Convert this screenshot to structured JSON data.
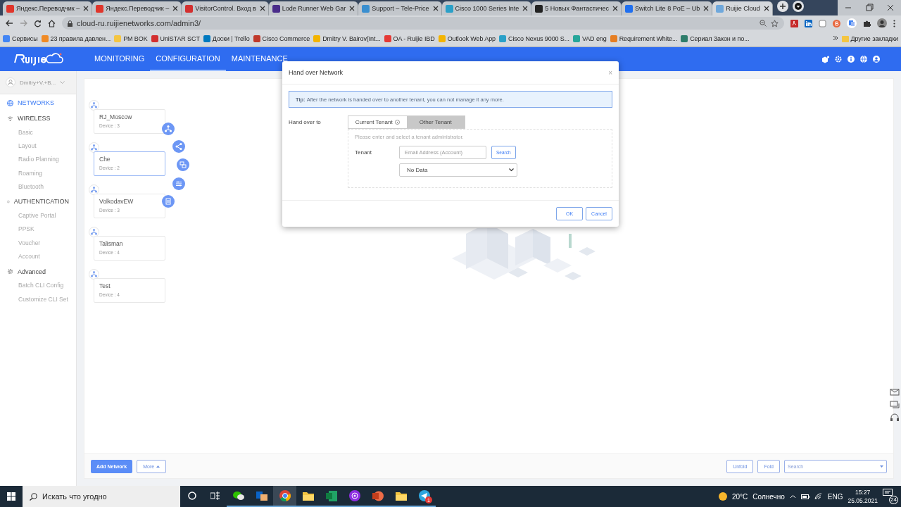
{
  "browser": {
    "tabs": [
      {
        "title": "Яндекс.Переводчик –",
        "color": "#e0352b",
        "selected": false
      },
      {
        "title": "Яндекс.Переводчик –",
        "color": "#e0352b",
        "selected": false
      },
      {
        "title": "VisitorControl. Вход в",
        "color": "#d32f2f",
        "selected": false
      },
      {
        "title": "Lode Runner Web Gar",
        "color": "#4a2c8a",
        "selected": false
      },
      {
        "title": "Support – Tele-Price",
        "color": "#3a8fd0",
        "selected": false
      },
      {
        "title": "Cisco 1000 Series Inte",
        "color": "#2aa0c8",
        "selected": false
      },
      {
        "title": "5 Новых Фантастичес",
        "color": "#222222",
        "selected": false
      },
      {
        "title": "Switch Lite 8 PoE – Ub",
        "color": "#1f6ff0",
        "selected": false
      },
      {
        "title": "Ruijie Cloud",
        "color": "#6fa8dc",
        "selected": true
      }
    ],
    "url": "cloud-ru.ruijienetworks.com/admin3/",
    "bookmarks": [
      {
        "label": "Сервисы",
        "color": "#4285f4"
      },
      {
        "label": "23 правила давлен...",
        "color": "#f08a24"
      },
      {
        "label": "PM BOK",
        "color": "#f4c542"
      },
      {
        "label": "UniSTAR SCT",
        "color": "#d32f2f"
      },
      {
        "label": "Доски | Trello",
        "color": "#0079bf"
      },
      {
        "label": "Cisco Commerce",
        "color": "#c0392b"
      },
      {
        "label": "Dmitry V. Bairov(Int...",
        "color": "#f4b400"
      },
      {
        "label": "OA - Ruijie IBD",
        "color": "#e53935"
      },
      {
        "label": "Outlook Web App",
        "color": "#f4b400"
      },
      {
        "label": "Cisco Nexus 9000 S...",
        "color": "#2aa0c8"
      },
      {
        "label": "VAD eng",
        "color": "#26a69a"
      },
      {
        "label": "Requirement White...",
        "color": "#e67e22"
      },
      {
        "label": "Сериал Закон и по...",
        "color": "#2e7d6b"
      }
    ],
    "other_bookmarks": "Другие закладки"
  },
  "app": {
    "nav": [
      {
        "label": "MONITORING",
        "selected": false
      },
      {
        "label": "CONFIGURATION",
        "selected": true
      },
      {
        "label": "MAINTENANCE",
        "selected": false
      }
    ],
    "account": "Dmitry+V.+B...",
    "sidebar": [
      {
        "label": "NETWORKS",
        "kind": "globe",
        "selected": true
      },
      {
        "label": "WIRELESS",
        "kind": "wifi",
        "selected": false,
        "children": [
          {
            "label": "Basic",
            "selected": false
          },
          {
            "label": "Layout",
            "selected": false
          },
          {
            "label": "Radio Planning",
            "selected": false
          },
          {
            "label": "Roaming",
            "selected": false
          },
          {
            "label": "Bluetooth",
            "selected": false
          }
        ]
      },
      {
        "label": "AUTHENTICATION",
        "kind": "info",
        "selected": false,
        "children": [
          {
            "label": "Captive Portal",
            "selected": false
          },
          {
            "label": "PPSK",
            "selected": false
          },
          {
            "label": "Voucher",
            "selected": false
          },
          {
            "label": "Account",
            "selected": false
          }
        ]
      },
      {
        "label": "Advanced",
        "kind": "gear",
        "selected": false,
        "children": [
          {
            "label": "Batch CLI Config",
            "selected": false
          },
          {
            "label": "Customize CLI Set",
            "selected": false
          }
        ]
      }
    ],
    "networks": [
      {
        "name": "RJ_Moscow",
        "devices": "Device : 3",
        "selected": false
      },
      {
        "name": "Che",
        "devices": "Device : 2",
        "selected": true
      },
      {
        "name": "VolkodavEW",
        "devices": "Device : 3",
        "selected": false
      },
      {
        "name": "Talisman",
        "devices": "Device : 4",
        "selected": false
      },
      {
        "name": "Test",
        "devices": "Device : 4",
        "selected": false
      }
    ],
    "footer": {
      "add": "Add Network",
      "more": "More",
      "unfold": "Unfold",
      "fold": "Fold",
      "search_placeholder": "Search"
    }
  },
  "dialog": {
    "title": "Hand over Network",
    "close": "×",
    "tip_label": "Tip:",
    "tip": "After the network is handed over to another tenant, you can not manage it any more.",
    "hand_over_label": "Hand over to",
    "options": [
      {
        "label": "Current Tenant",
        "selected": false
      },
      {
        "label": "Other Tenant",
        "selected": true
      }
    ],
    "hint": "Please enter and select a tenant administrator.",
    "tenant_label": "Tenant",
    "email_placeholder": "Email Address (Account)",
    "search": "Search",
    "select_value": "No Data",
    "ok": "OK",
    "cancel": "Cancel"
  },
  "taskbar": {
    "search_placeholder": "Искать что угодно",
    "apps": [
      {
        "kind": "chat",
        "selected": false
      },
      {
        "kind": "mail",
        "selected": false
      },
      {
        "kind": "browser",
        "selected": true
      },
      {
        "kind": "folder",
        "selected": false
      },
      {
        "kind": "sheet",
        "selected": false
      },
      {
        "kind": "podcast",
        "selected": false
      },
      {
        "kind": "slides",
        "selected": false
      },
      {
        "kind": "folder",
        "selected": false
      },
      {
        "kind": "messenger",
        "selected": false,
        "badge": "1"
      }
    ],
    "temperature": "20°C",
    "weather": "Солнечно",
    "language": "ENG",
    "time": "15:27",
    "date": "25.05.2021",
    "notifications": "24"
  }
}
